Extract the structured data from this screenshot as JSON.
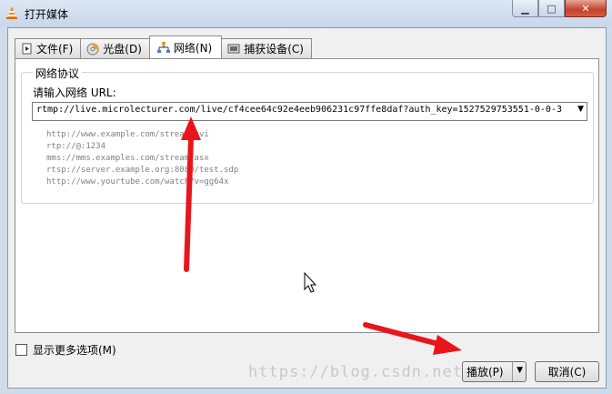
{
  "window": {
    "title": "打开媒体",
    "min_icon": "minimize-icon",
    "max_icon": "maximize-icon",
    "close_icon": "close-icon"
  },
  "tabs": [
    {
      "label": "文件(F)",
      "icon": "file-icon"
    },
    {
      "label": "光盘(D)",
      "icon": "disc-icon"
    },
    {
      "label": "网络(N)",
      "icon": "network-icon"
    },
    {
      "label": "捕获设备(C)",
      "icon": "capture-device-icon"
    }
  ],
  "active_tab": "网络(N)",
  "network": {
    "group_title": "网络协议",
    "url_label": "请输入网络 URL:",
    "url_value": "rtmp://live.microlecturer.com/live/cf4cee64c92e4eeb906231c97ffe8daf?auth_key=1527529753551-0-0-3",
    "examples": [
      "http://www.example.com/stream.avi",
      "rtp://@:1234",
      "mms://mms.examples.com/stream.asx",
      "rtsp://server.example.org:8080/test.sdp",
      "http://www.yourtube.com/watch?v=gg64x"
    ]
  },
  "footer": {
    "show_more_label": "显示更多选项(M)",
    "show_more_checked": false,
    "play_label": "播放(P)",
    "cancel_label": "取消(C)",
    "watermark": "https://blog.csdn.net/lo..."
  },
  "annotations": {
    "arrow_color": "#e8161b"
  }
}
